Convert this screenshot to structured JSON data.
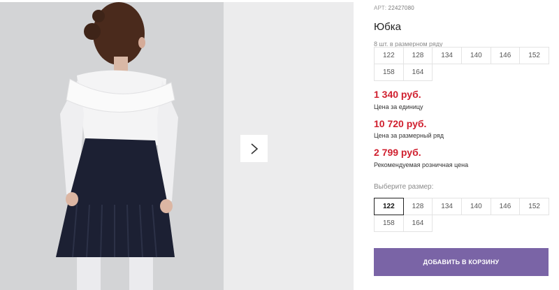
{
  "product": {
    "sku_label": "АРТ:",
    "sku_value": "22427080",
    "title": "Юбка"
  },
  "row_sizes": {
    "caption": "8 шт. в размерном ряду",
    "sizes": [
      "122",
      "128",
      "134",
      "140",
      "146",
      "152",
      "158",
      "164"
    ]
  },
  "prices": {
    "unit": {
      "value": "1 340 руб.",
      "note": "Цена за единицу"
    },
    "row": {
      "value": "10 720 руб.",
      "note": "Цена за размерный ряд"
    },
    "retail": {
      "value": "2 799 руб.",
      "note": "Рекомендуемая розничная цена"
    }
  },
  "size_select": {
    "caption": "Выберите размер:",
    "sizes": [
      "122",
      "128",
      "134",
      "140",
      "146",
      "152",
      "158",
      "164"
    ],
    "selected": "122"
  },
  "cart": {
    "label": "ДОБАВИТЬ В КОРЗИНУ"
  },
  "colors": {
    "price_red": "#d0202f",
    "button_purple": "#7a64a6",
    "skirt_navy": "#1c2033"
  },
  "icons": {
    "next": "chevron-right-icon"
  }
}
